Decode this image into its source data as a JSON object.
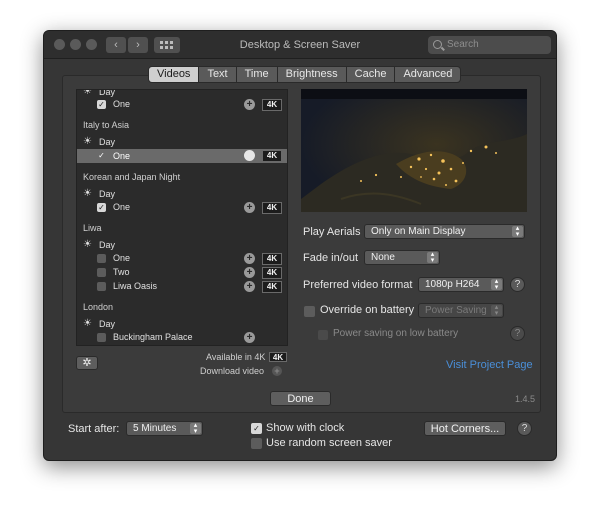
{
  "window": {
    "title": "Desktop & Screen Saver",
    "search_placeholder": "Search"
  },
  "tabs": [
    {
      "label": "Videos",
      "active": true
    },
    {
      "label": "Text"
    },
    {
      "label": "Time"
    },
    {
      "label": "Brightness"
    },
    {
      "label": "Cache"
    },
    {
      "label": "Advanced"
    }
  ],
  "list": {
    "day": "Day",
    "one": "One",
    "two": "Two",
    "k4": "4K",
    "groups": {
      "italy": "Italy to Asia",
      "korea": "Korean and Japan Night",
      "liwa": "Liwa",
      "london": "London"
    },
    "liwa_oasis": "Liwa Oasis",
    "buckingham": "Buckingham Palace",
    "available_4k": "Available in 4K",
    "download_video": "Download video"
  },
  "settings": {
    "play_aerials_label": "Play Aerials",
    "play_aerials_value": "Only on Main Display",
    "fade_label": "Fade in/out",
    "fade_value": "None",
    "format_label": "Preferred video format",
    "format_value": "1080p H264",
    "override_label": "Override on battery",
    "power_saving_value": "Power Saving",
    "power_low_label": "Power saving on low battery",
    "visit_link": "Visit Project Page",
    "version": "1.4.5",
    "done": "Done"
  },
  "footer": {
    "start_after_label": "Start after:",
    "start_after_value": "5 Minutes",
    "show_clock": "Show with clock",
    "random_saver": "Use random screen saver",
    "hot_corners": "Hot Corners..."
  },
  "colors": {
    "link": "#4a8fd9",
    "window_bg": "#363636",
    "list_bg": "#2b2b2b"
  }
}
